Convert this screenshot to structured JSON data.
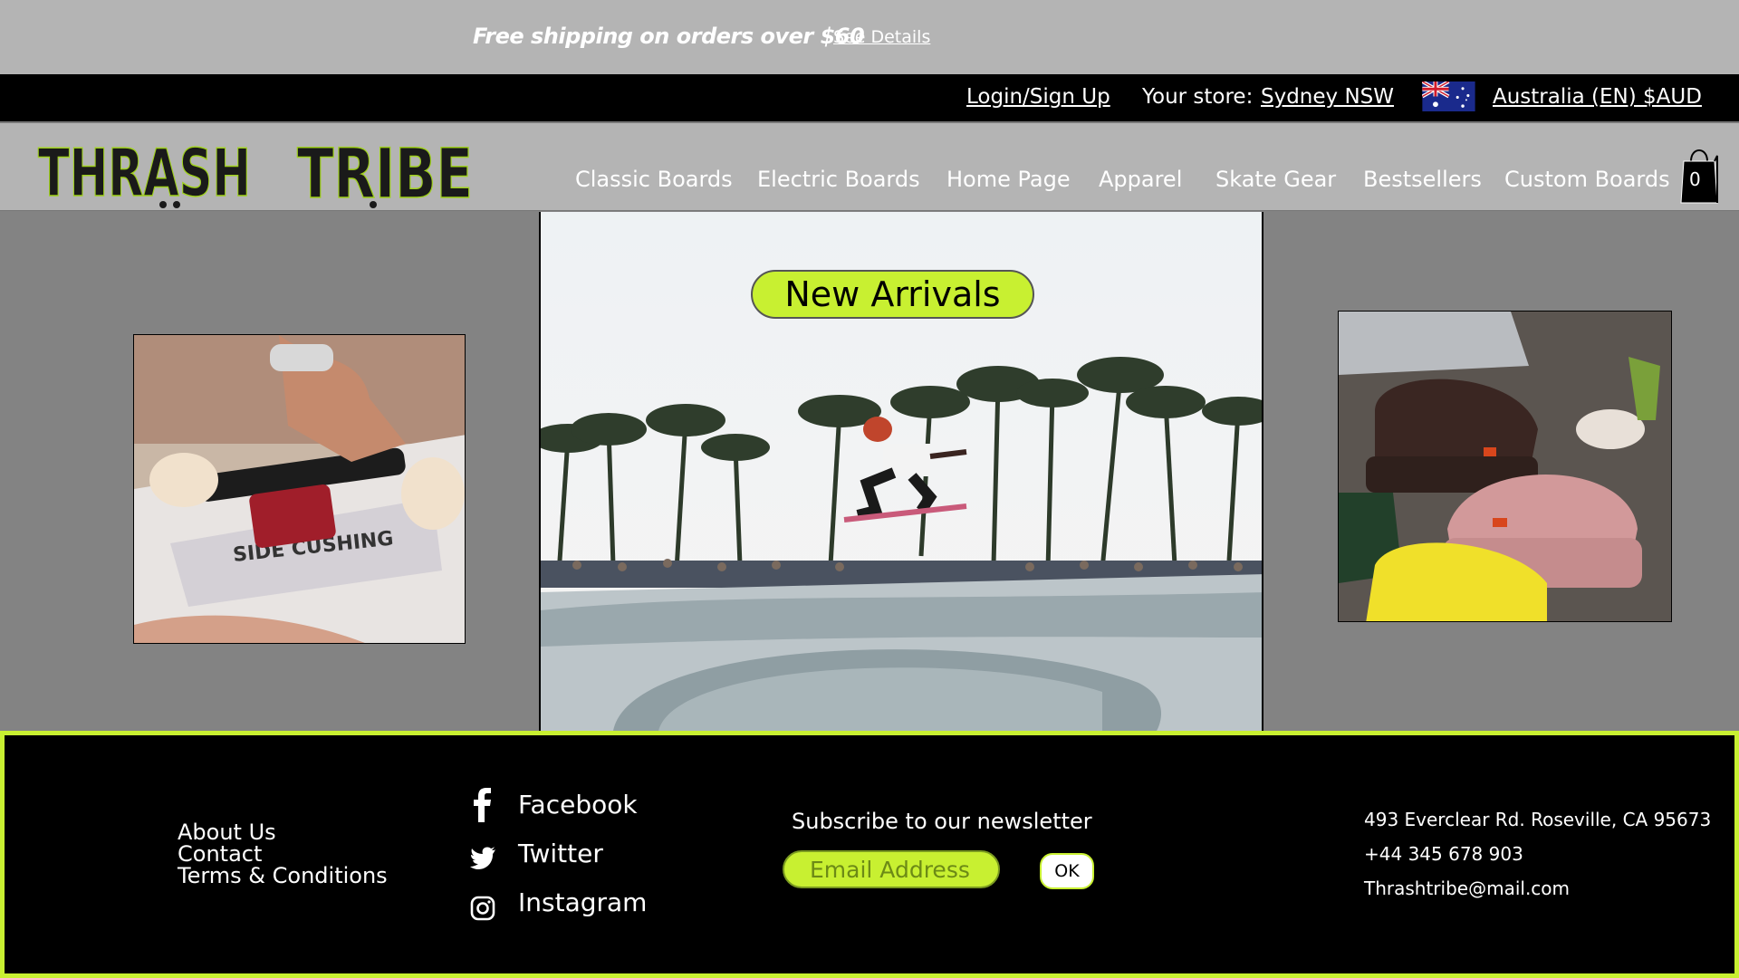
{
  "promo": {
    "text": "Free shipping on orders over $60",
    "link": "See Details"
  },
  "account": {
    "login": "Login/Sign Up",
    "store_prefix": "Your store:",
    "store_link": "Sydney NSW",
    "region": "Australia (EN) $AUD"
  },
  "logo": {
    "text": "THRASH TRIBE"
  },
  "nav": {
    "items": [
      "Classic Boards",
      "Electric Boards",
      "Home Page",
      "Apparel",
      "Skate Gear",
      "Bestsellers",
      "Custom Boards"
    ],
    "cart_count": "0"
  },
  "hero": {
    "badge": "New Arrivals"
  },
  "footer": {
    "links": [
      "About Us",
      "Contact",
      "Terms & Conditions"
    ],
    "social": [
      {
        "label": "Facebook",
        "icon": "facebook-icon"
      },
      {
        "label": "Twitter",
        "icon": "twitter-icon"
      },
      {
        "label": "Instagram",
        "icon": "instagram-icon"
      }
    ],
    "newsletter": {
      "title": "Subscribe to our newsletter",
      "placeholder": "Email Address",
      "button": "OK"
    },
    "contact": {
      "address": "493 Everclear Rd. Roseville, CA 95673",
      "phone": "+44 345 678 903",
      "email": "Thrashtribe@mail.com"
    }
  },
  "colors": {
    "accent": "#c8f031",
    "header_gray": "#b4b4b4",
    "body_gray": "#838383",
    "black": "#000000"
  }
}
